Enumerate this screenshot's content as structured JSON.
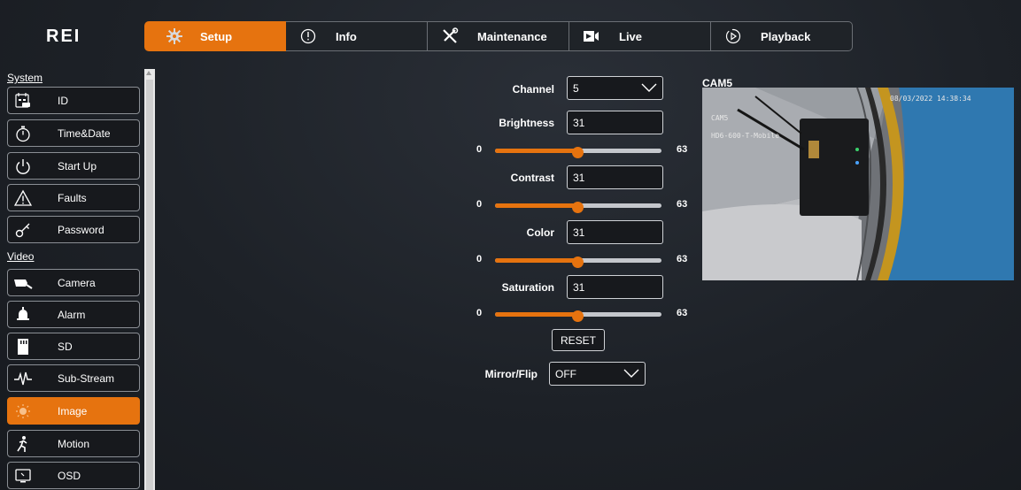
{
  "brand": {
    "logo_text": "REI"
  },
  "nav": {
    "tabs": [
      {
        "label": "Setup",
        "icon": "gear-icon",
        "active": true
      },
      {
        "label": "Info",
        "icon": "info-icon"
      },
      {
        "label": "Maintenance",
        "icon": "tools-icon"
      },
      {
        "label": "Live",
        "icon": "video-camera-icon"
      },
      {
        "label": "Playback",
        "icon": "playback-icon"
      }
    ]
  },
  "sidebar": {
    "system_header": "System",
    "video_header": "Video",
    "system_items": [
      {
        "label": "ID",
        "icon": "id-icon"
      },
      {
        "label": "Time&Date",
        "icon": "stopwatch-icon"
      },
      {
        "label": "Start Up",
        "icon": "power-icon"
      },
      {
        "label": "Faults",
        "icon": "warning-icon"
      },
      {
        "label": "Password",
        "icon": "key-icon"
      }
    ],
    "video_items": [
      {
        "label": "Camera",
        "icon": "camera-icon"
      },
      {
        "label": "Alarm",
        "icon": "bell-icon"
      },
      {
        "label": "SD",
        "icon": "sd-card-icon"
      },
      {
        "label": "Sub-Stream",
        "icon": "waveform-icon"
      },
      {
        "label": "Image",
        "icon": "image-icon",
        "active": true
      },
      {
        "label": "Motion",
        "icon": "running-person-icon"
      },
      {
        "label": "OSD",
        "icon": "monitor-icon"
      }
    ]
  },
  "image_settings": {
    "channel": {
      "label": "Channel",
      "value": "5"
    },
    "brightness": {
      "label": "Brightness",
      "value": "31",
      "min": "0",
      "max": "63",
      "level": 31
    },
    "contrast": {
      "label": "Contrast",
      "value": "31",
      "min": "0",
      "max": "63",
      "level": 31
    },
    "color": {
      "label": "Color",
      "value": "31",
      "min": "0",
      "max": "63",
      "level": 31
    },
    "saturation": {
      "label": "Saturation",
      "value": "31",
      "min": "0",
      "max": "63",
      "level": 31
    },
    "reset_label": "RESET",
    "mirror_flip": {
      "label": "Mirror/Flip",
      "value": "OFF"
    }
  },
  "preview": {
    "title": "CAM5",
    "osd_timestamp": "08/03/2022 14:38:34",
    "osd_channel": "CAM5",
    "osd_device": "HD6-600-T-Mobile"
  },
  "colors": {
    "accent": "#e6730f",
    "background": "#1d2127"
  }
}
